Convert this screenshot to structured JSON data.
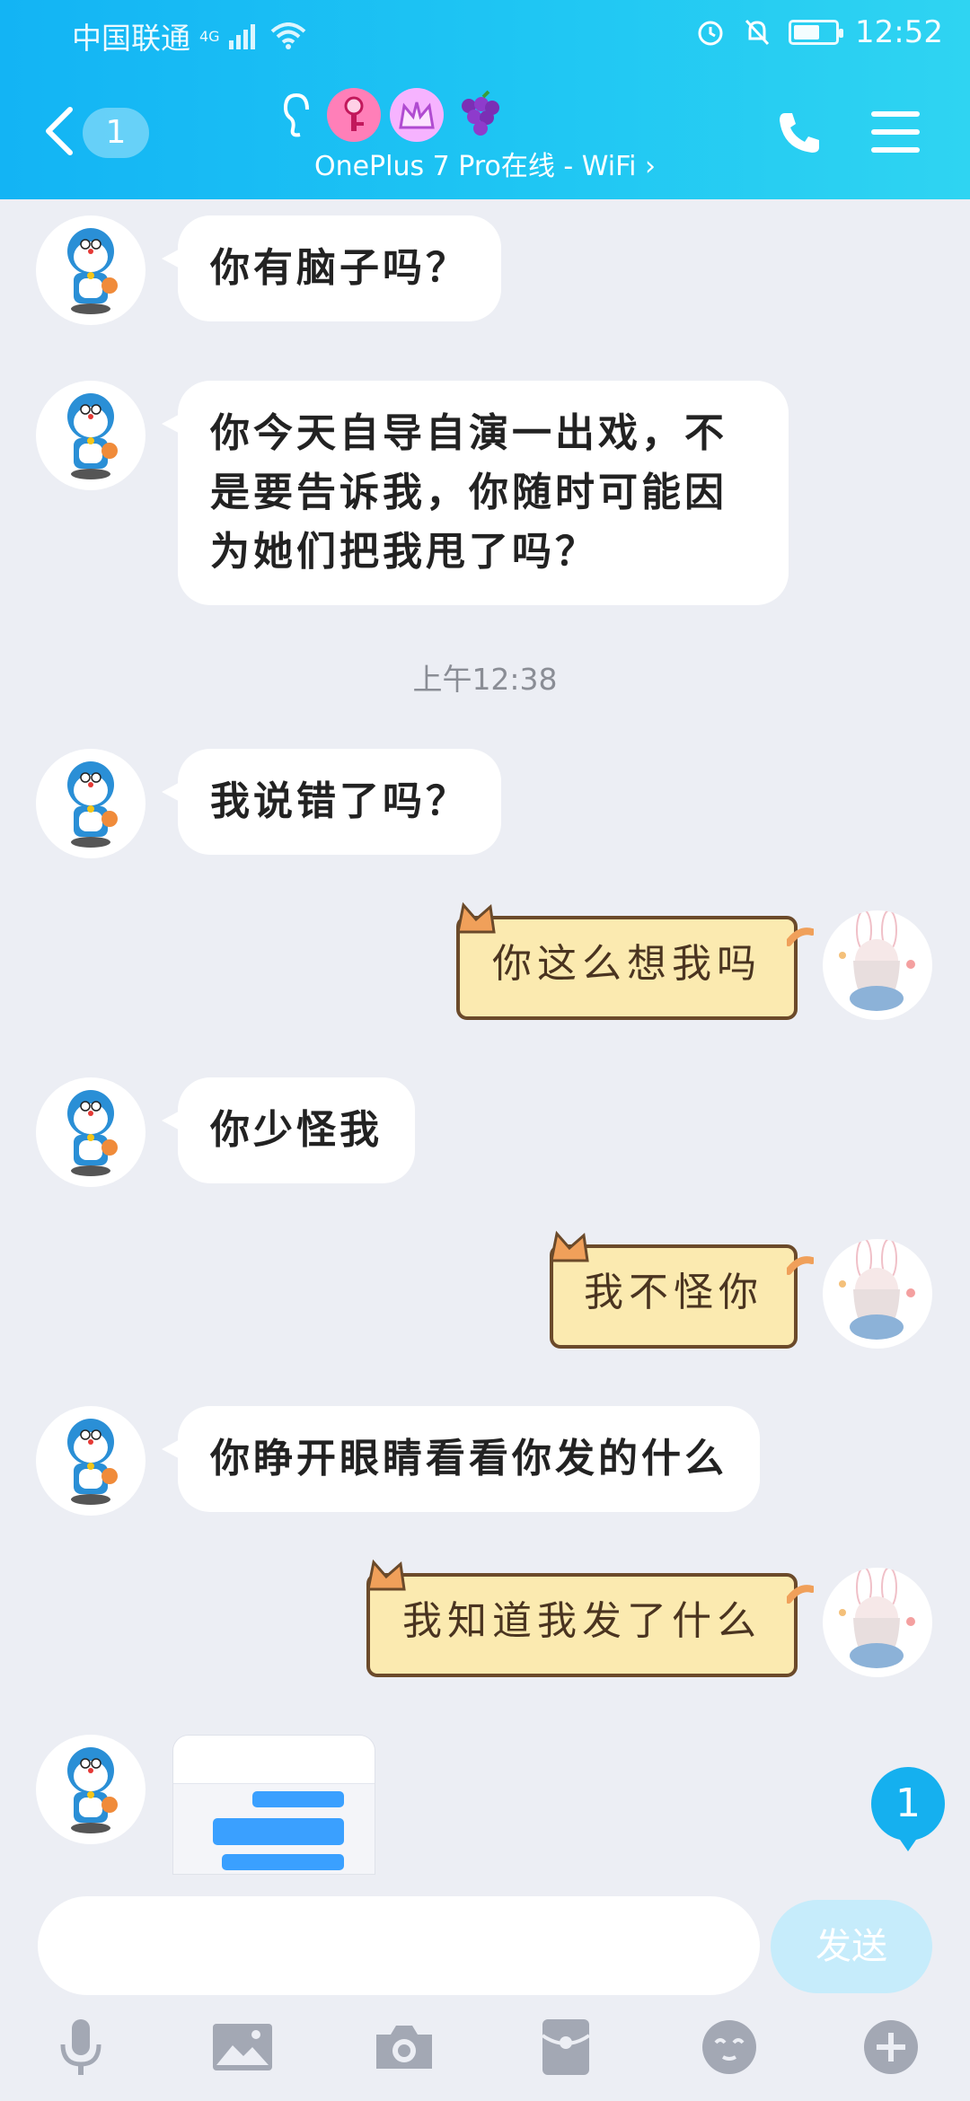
{
  "status_bar": {
    "carrier": "中国联通",
    "network": "4G",
    "time": "12:52",
    "battery_level": 0.55
  },
  "header": {
    "unread_count": "1",
    "contact_status": "OnePlus 7 Pro在线 - WiFi ›",
    "badge_icons": [
      "ear-icon",
      "key-icon",
      "crown-icon",
      "grape-icon"
    ]
  },
  "messages": [
    {
      "side": "left",
      "text": "你有脑子吗？"
    },
    {
      "side": "left",
      "lines": [
        "你今天自导自演一出戏，不",
        "是要告诉我，你随时可能因",
        "为她们把我甩了吗？"
      ]
    },
    {
      "side": "time",
      "text": "上午12:38"
    },
    {
      "side": "left",
      "text": "我说错了吗？"
    },
    {
      "side": "right",
      "text": "你这么想我吗"
    },
    {
      "side": "left",
      "text": "你少怪我"
    },
    {
      "side": "right",
      "text": "我不怪你"
    },
    {
      "side": "left",
      "text": "你睁开眼睛看看你发的什么"
    },
    {
      "side": "right",
      "text": "我知道我发了什么"
    },
    {
      "side": "left",
      "type": "image",
      "text": "screenshot"
    }
  ],
  "floating_badge": "1",
  "input": {
    "placeholder": "",
    "send_label": "发送"
  },
  "toolbar": [
    "microphone-icon",
    "picture-icon",
    "camera-icon",
    "red-packet-icon",
    "emoji-icon",
    "plus-icon"
  ],
  "colors": {
    "header_start": "#13b4f4",
    "header_end": "#2fd4f2",
    "background": "#eceef4",
    "sticker_bubble": "#fbeab0",
    "send_disabled": "#c6ecfb"
  }
}
